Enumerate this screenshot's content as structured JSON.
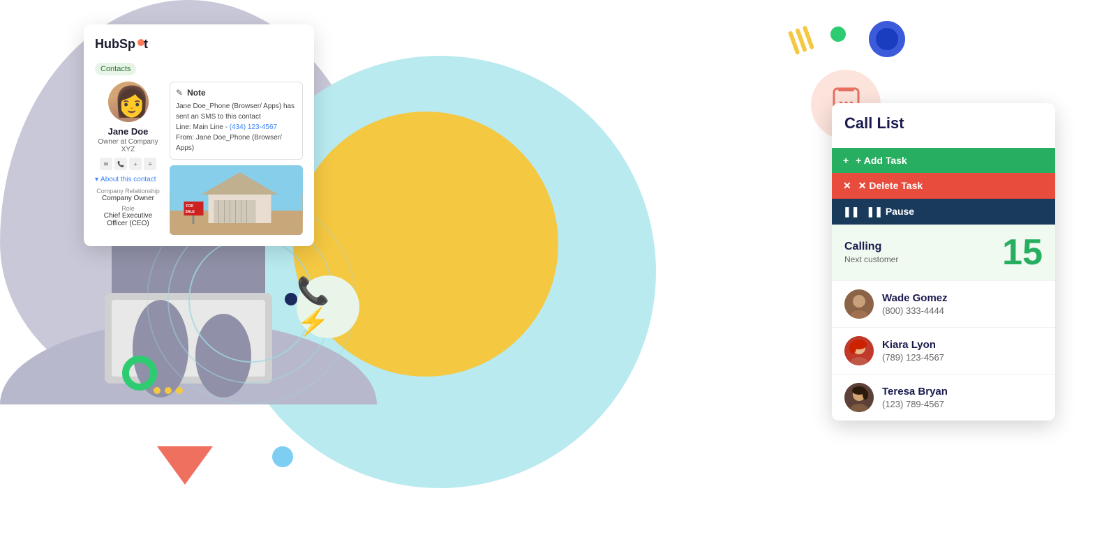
{
  "background": {
    "teal_circle": "decorative",
    "yellow_circle": "decorative"
  },
  "decorative": {
    "green_dot_top_color": "#2ecc71",
    "blue_circle_color": "#3b5bdb",
    "yellow_lines_color": "#f5c842",
    "triangle_color": "#f07060"
  },
  "hubspot_card": {
    "logo_text": "HubSp",
    "logo_highlight": "ot",
    "contacts_badge": "Contacts",
    "contact": {
      "name": "Jane Doe",
      "title": "Owner at Company XYZ",
      "edit_icon": "✎"
    },
    "about_section": {
      "title": "About this contact",
      "fields": [
        {
          "label": "Company Relationship",
          "value": "Company Owner"
        },
        {
          "label": "Role",
          "value": "Chief Executive Officer (CEO)"
        }
      ]
    },
    "note": {
      "label": "Note",
      "text_line1": "Jane Doe_Phone (Browser/ Apps) has sent an SMS to this contact",
      "text_line2": "Line: Main Line - (434) 123-4567",
      "text_line3": "From: Jane Doe_Phone (Browser/ Apps)",
      "phone_number": "(434) 123-4567"
    }
  },
  "call_list": {
    "title": "Call List",
    "buttons": {
      "add": "+ Add Task",
      "delete": "✕ Delete Task",
      "pause": "❚❚ Pause"
    },
    "calling": {
      "label": "Calling",
      "sub_label": "Next customer",
      "number": "15"
    },
    "contacts": [
      {
        "name": "Wade Gomez",
        "phone": "(800) 333-4444",
        "avatar_emoji": "🧑"
      },
      {
        "name": "Kiara Lyon",
        "phone": "(789) 123-4567",
        "avatar_emoji": "👩"
      },
      {
        "name": "Teresa Bryan",
        "phone": "(123) 789-4567",
        "avatar_emoji": "👩"
      }
    ]
  }
}
